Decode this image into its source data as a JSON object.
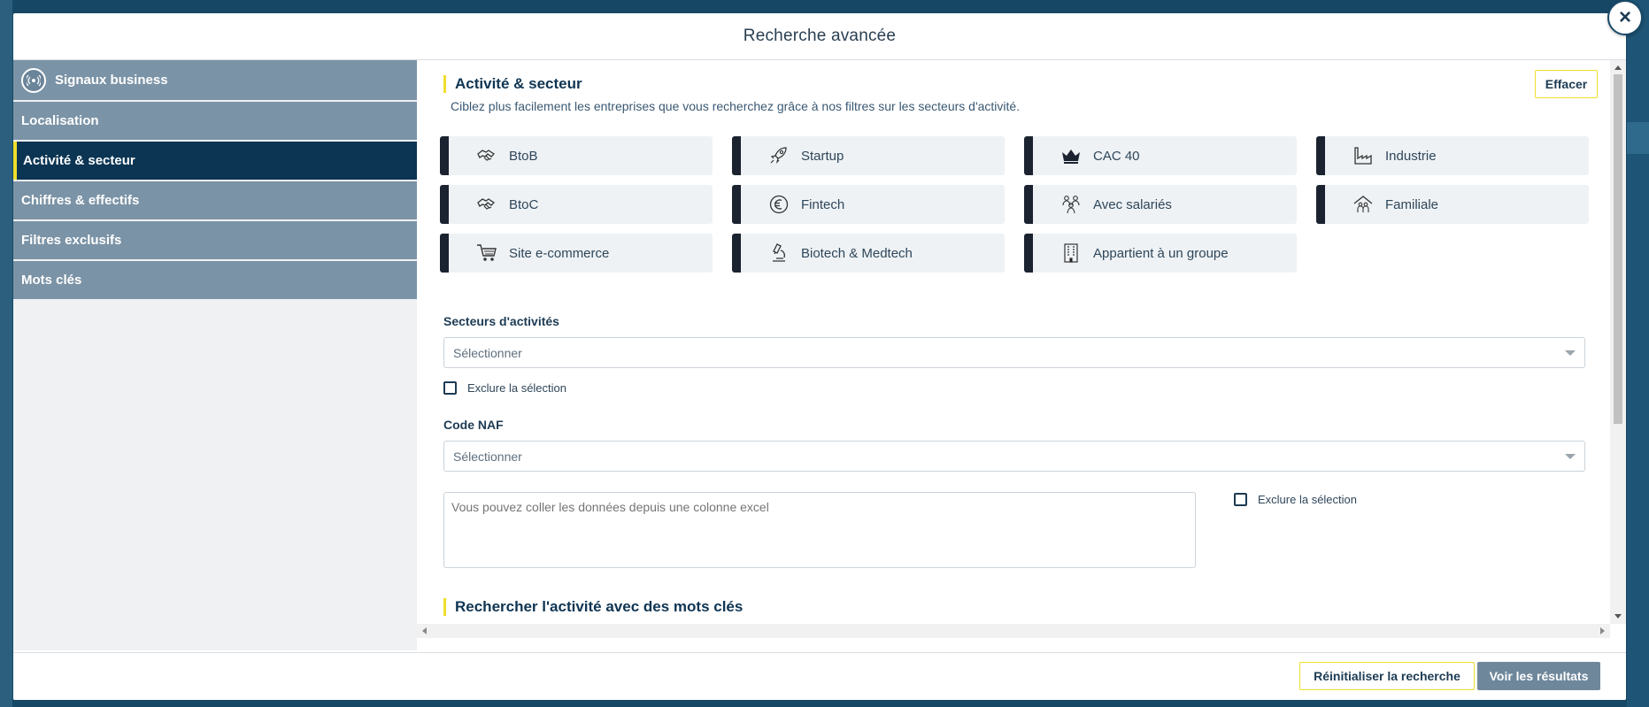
{
  "modal": {
    "title": "Recherche avancée",
    "close_label": "×"
  },
  "sidebar": {
    "items": [
      {
        "label": "Signaux business",
        "icon": "signal-icon"
      },
      {
        "label": "Localisation"
      },
      {
        "label": "Activité & secteur",
        "active": true
      },
      {
        "label": "Chiffres & effectifs"
      },
      {
        "label": "Filtres exclusifs"
      },
      {
        "label": "Mots clés"
      }
    ]
  },
  "section": {
    "title": "Activité & secteur",
    "description": "Ciblez plus facilement les entreprises que vous recherchez grâce à nos filtres sur les secteurs d'activité.",
    "clear_label": "Effacer"
  },
  "tiles": [
    {
      "label": "BtoB",
      "icon": "handshake-icon"
    },
    {
      "label": "Startup",
      "icon": "rocket-icon"
    },
    {
      "label": "CAC 40",
      "icon": "crown-icon"
    },
    {
      "label": "Industrie",
      "icon": "factory-icon"
    },
    {
      "label": "BtoC",
      "icon": "handshake-icon"
    },
    {
      "label": "Fintech",
      "icon": "euro-icon"
    },
    {
      "label": "Avec salariés",
      "icon": "people-icon"
    },
    {
      "label": "Familiale",
      "icon": "family-house-icon"
    },
    {
      "label": "Site e-commerce",
      "icon": "cart-icon"
    },
    {
      "label": "Biotech & Medtech",
      "icon": "microscope-icon"
    },
    {
      "label": "Appartient à un groupe",
      "icon": "building-icon"
    }
  ],
  "sectors": {
    "label": "Secteurs d'activités",
    "placeholder": "Sélectionner",
    "exclude_label": "Exclure la sélection"
  },
  "naf": {
    "label": "Code NAF",
    "placeholder": "Sélectionner",
    "textarea_placeholder": "Vous pouvez coller les données depuis une colonne excel",
    "exclude_label": "Exclure la sélection"
  },
  "keywords_section": {
    "title": "Rechercher l'activité avec des mots clés"
  },
  "footer": {
    "reset_label": "Réinitialiser la recherche",
    "results_label": "Voir les résultats"
  },
  "colors": {
    "accent": "#f0df2b",
    "navy": "#0b3553",
    "sidebar_item": "#7b93a6"
  }
}
